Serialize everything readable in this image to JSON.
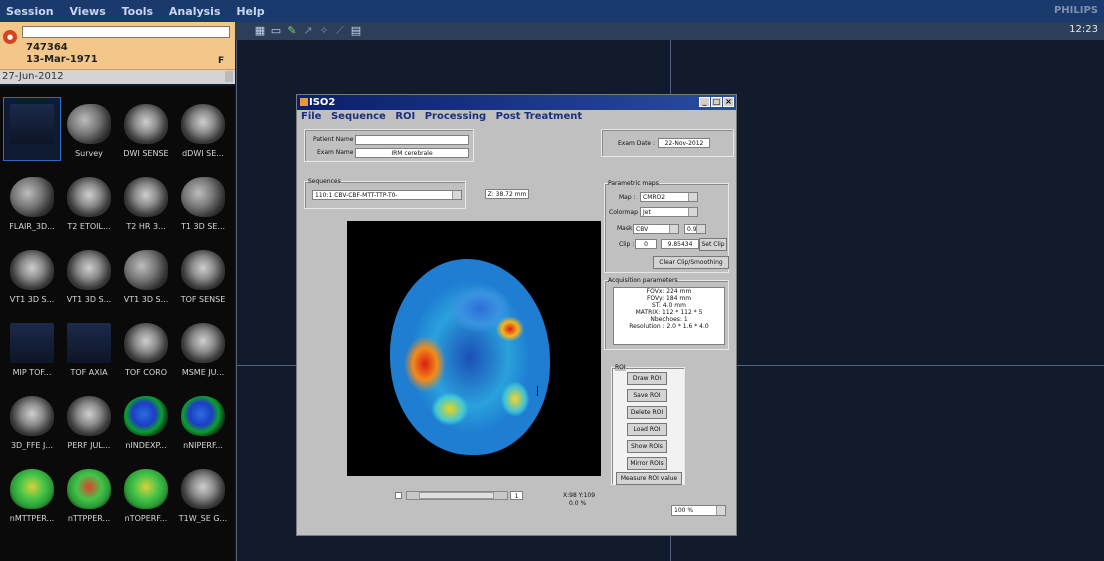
{
  "menubar": {
    "items": [
      "Session",
      "Views",
      "Tools",
      "Analysis",
      "Help"
    ],
    "brand": "PHILIPS"
  },
  "toolbar": {
    "icons": [
      "grid-icon",
      "folder-icon",
      "wand-icon",
      "arrow-icon",
      "tool-icon",
      "ruler-icon",
      "print-icon"
    ],
    "time": "12:23"
  },
  "patient": {
    "id": "747364",
    "dob": "13-Mar-1971",
    "sex": "F",
    "study_date": "27-Jun-2012"
  },
  "series": [
    {
      "label": "",
      "style": "screen"
    },
    {
      "label": "Survey",
      "style": "sag"
    },
    {
      "label": "DWI SENSE",
      "style": "axial"
    },
    {
      "label": "dDWI SE...",
      "style": "axial"
    },
    {
      "label": "FLAIR_3D...",
      "style": "sag"
    },
    {
      "label": "T2 ETOIL...",
      "style": "axial"
    },
    {
      "label": "T2 HR 3...",
      "style": "axial"
    },
    {
      "label": "T1 3D SE...",
      "style": "sag"
    },
    {
      "label": "VT1 3D S...",
      "style": "axial"
    },
    {
      "label": "VT1 3D S...",
      "style": "axial"
    },
    {
      "label": "VT1 3D S...",
      "style": "sag"
    },
    {
      "label": "TOF SENSE",
      "style": "axial"
    },
    {
      "label": "MIP TOF...",
      "style": "screen"
    },
    {
      "label": "TOF AXIA",
      "style": "screen"
    },
    {
      "label": "TOF CORO",
      "style": "axial"
    },
    {
      "label": "MSME JU...",
      "style": "axial"
    },
    {
      "label": "3D_FFE J...",
      "style": "axial"
    },
    {
      "label": "PERF JUL...",
      "style": "axial"
    },
    {
      "label": "nINDEXP...",
      "style": "map"
    },
    {
      "label": "nNIPERF...",
      "style": "map"
    },
    {
      "label": "nMTTPER...",
      "style": "green"
    },
    {
      "label": "nTTPPER...",
      "style": "green2"
    },
    {
      "label": "nTOPERF...",
      "style": "green"
    },
    {
      "label": "T1W_SE G...",
      "style": "axial"
    }
  ],
  "iso2": {
    "title": "ISO2",
    "menu": [
      "File",
      "Sequence",
      "ROI",
      "Processing",
      "Post Treatment"
    ],
    "patient_name_label": "Patient Name :",
    "patient_name_value": "",
    "exam_name_label": "Exam Name :",
    "exam_name_value": "IRM cerebrale",
    "exam_date_label": "Exam Date :",
    "exam_date_value": "22-Nov-2012",
    "sequences_label": "Sequences",
    "sequence_value": "110:1 CBV-CBF-MTT-TTP-T0-",
    "z_value": "Z: 38.72 mm",
    "param_maps_label": "Parametric maps",
    "map_label": "Map :",
    "map_value": "CMRO2",
    "colormap_label": "Colormap :",
    "colormap_value": "Jet",
    "mask_label": "Mask :",
    "mask_value": "CBV",
    "mask_threshold": "0.9",
    "clip_label": "Clip :",
    "clip_min": "0",
    "clip_max": "9.85434",
    "set_clip": "Set Clip",
    "clear_clip": "Clear Clip/Smoothing",
    "acq_label": "Acquisition parameters",
    "acq_lines": [
      "FOVx: 224 mm",
      "FOVy: 184 mm",
      "ST: 4.0 mm",
      "MATRIX: 112 * 112 * 5",
      "Nbechoes: 1",
      "Resolution : 2.0 * 1.6 * 4.0"
    ],
    "roi_label": "ROI",
    "roi_buttons": [
      "Draw ROI",
      "Save ROI",
      "Delete ROI",
      "Load ROI",
      "Show ROIs",
      "Mirror ROIs",
      "Measure ROI value"
    ],
    "slice_value": "1",
    "coords": "X:98 Y:109",
    "pct": "0.0 %",
    "zoom": "100 %"
  }
}
